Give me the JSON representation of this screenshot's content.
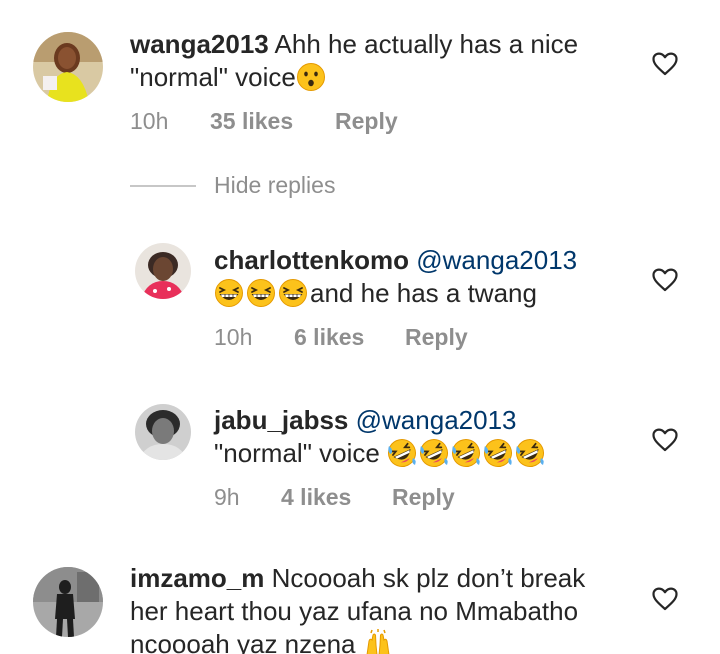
{
  "comments": [
    {
      "username": "wanga2013",
      "text": "Ahh he actually has a nice \"normal\" voice",
      "time": "10h",
      "likes": "35 likes",
      "reply": "Reply"
    }
  ],
  "hide_replies": "Hide replies",
  "replies": [
    {
      "username": "charlottenkomo",
      "mention": "@wanga2013",
      "text": "and he has a twang",
      "time": "10h",
      "likes": "6 likes",
      "reply": "Reply"
    },
    {
      "username": "jabu_jabss",
      "mention": "@wanga2013",
      "text": "\"normal\" voice",
      "time": "9h",
      "likes": "4 likes",
      "reply": "Reply"
    }
  ],
  "last_comment": {
    "username": "imzamo_m",
    "text": "Ncoooah sk plz don’t break her heart thou yaz ufana no Mmabatho ncoooah yaz nzena"
  },
  "colors": {
    "text": "#262626",
    "mention": "#00376b",
    "meta": "#8e8e8e",
    "divider": "#c7c7c7"
  },
  "icons": {
    "heart": "heart-outline-icon",
    "emoji_hushed": "hushed-face-emoji",
    "emoji_grin": "grinning-squinting-face-emoji",
    "emoji_rofl": "rolling-on-floor-laughing-emoji",
    "emoji_hands": "raising-hands-emoji"
  }
}
